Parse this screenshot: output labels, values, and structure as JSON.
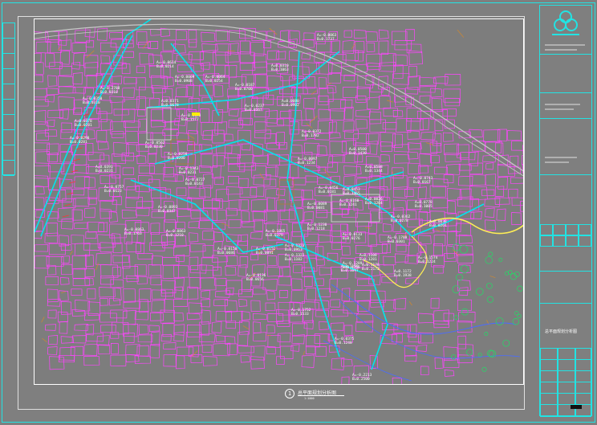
{
  "drawing": {
    "caption_number": "1",
    "caption_title": "总平面规划分析图",
    "caption_scale": "1:1000",
    "title_block_label": "总平面规划分析图",
    "logo_name": "tri-circle-logo",
    "colors": {
      "frame": "#22e3e3",
      "buildings": "#ff44ff",
      "roads": "#00e5ee",
      "labels": "#ffffff",
      "highlight": "#ffee00",
      "water": "#4a6cff"
    }
  },
  "slope_labels": [
    {
      "a": "A=-0.0063",
      "b": "B=0.1737"
    },
    {
      "a": "A=-0.0614",
      "b": "B=0.0214"
    },
    {
      "a": "A=0.0310",
      "b": "B=0.1063"
    },
    {
      "a": "A=-0.0009",
      "b": "B=0.0908"
    },
    {
      "a": "A=-0.0064",
      "b": "B=0.0254"
    },
    {
      "a": "A=-0.0187",
      "b": "B=0.0700"
    },
    {
      "a": "A=-0.2788",
      "b": "B=0.0318"
    },
    {
      "a": "A=0.0371",
      "b": "B=0.0678"
    },
    {
      "a": "A=0.0080",
      "b": "B=0.0902"
    },
    {
      "a": "A=-0.0350",
      "b": "B=0.0310"
    },
    {
      "a": "A=0.0378",
      "b": "B=0.0281"
    },
    {
      "a": "A=-0.0290",
      "b": "B=0.0281"
    },
    {
      "a": "A=-0.0372",
      "b": "B=0.1782"
    },
    {
      "a": "A=-0.0237",
      "b": "B=0.0167"
    },
    {
      "a": "A=-0.0088",
      "b": "B=0.1577"
    },
    {
      "a": "A=-0.0562",
      "b": "B=0.0230"
    },
    {
      "a": "A=-0.0250",
      "b": "B=0.0200"
    },
    {
      "a": "A=0.0391",
      "b": "B=0.0231"
    },
    {
      "a": "A=-0.1343",
      "b": "B=0.0231"
    },
    {
      "a": "A=-0.0097",
      "b": "B=0.1234"
    },
    {
      "a": "A=0.0500",
      "b": "B=0.1430"
    },
    {
      "a": "A=0.0588",
      "b": "B=0.1344"
    },
    {
      "a": "A=-0.0743",
      "b": "B=0.0167"
    },
    {
      "a": "A=-0.0757",
      "b": "B=0.0123"
    },
    {
      "a": "A=-0.0727",
      "b": "B=0.0143"
    },
    {
      "a": "A=-0.0456",
      "b": "B=0.0181"
    },
    {
      "a": "A=0.0453",
      "b": "B=0.1465"
    },
    {
      "a": "A=-0.0089",
      "b": "B=0.0081"
    },
    {
      "a": "A=0.0026",
      "b": "B=0.1204"
    },
    {
      "a": "A=0.0778",
      "b": "B=0.1005"
    },
    {
      "a": "A=-0.0893",
      "b": "B=0.0347"
    },
    {
      "a": "A=-0.0863",
      "b": "B=0.1210"
    },
    {
      "a": "A=-0.0160",
      "b": "B=0.1241"
    },
    {
      "a": "A=-0.0362",
      "b": "B=0.0278"
    },
    {
      "a": "A=0.0038",
      "b": "B=0.0261"
    },
    {
      "a": "A=-0.1709",
      "b": "B=0.0301"
    },
    {
      "a": "A=-0.1865",
      "b": "B=0.0379"
    },
    {
      "a": "A=-0.0152",
      "b": "B=0.0091"
    },
    {
      "a": "A=-0.1323",
      "b": "B=0.0963"
    },
    {
      "a": "A=-0.0133",
      "b": "B=0.0276"
    },
    {
      "a": "A=-0.1230",
      "b": "B=0.1218"
    },
    {
      "a": "A=-0.0863",
      "b": "B=0.1763"
    },
    {
      "a": "A=0.1108",
      "b": "B=0.1281"
    },
    {
      "a": "A=-0.0150",
      "b": "B=0.0686"
    },
    {
      "a": "A=-0.1322",
      "b": "B=0.1102"
    },
    {
      "a": "A=0.1159",
      "b": "B=0.1697"
    },
    {
      "a": "A=0.1178",
      "b": "B=0.2172"
    },
    {
      "a": "A=-0.1289",
      "b": "B=0.4758"
    },
    {
      "a": "A=0.1172",
      "b": "B=0.1938"
    },
    {
      "a": "A=-0.1574",
      "b": "B=0.1224"
    },
    {
      "a": "A=-0.0136",
      "b": "B=0.0656"
    },
    {
      "a": "A=-0.1752",
      "b": "B=0.1533"
    },
    {
      "a": "A=-0.0375",
      "b": "B=0.1248"
    },
    {
      "a": "A=-0.2213",
      "b": "B=0.2500"
    }
  ]
}
